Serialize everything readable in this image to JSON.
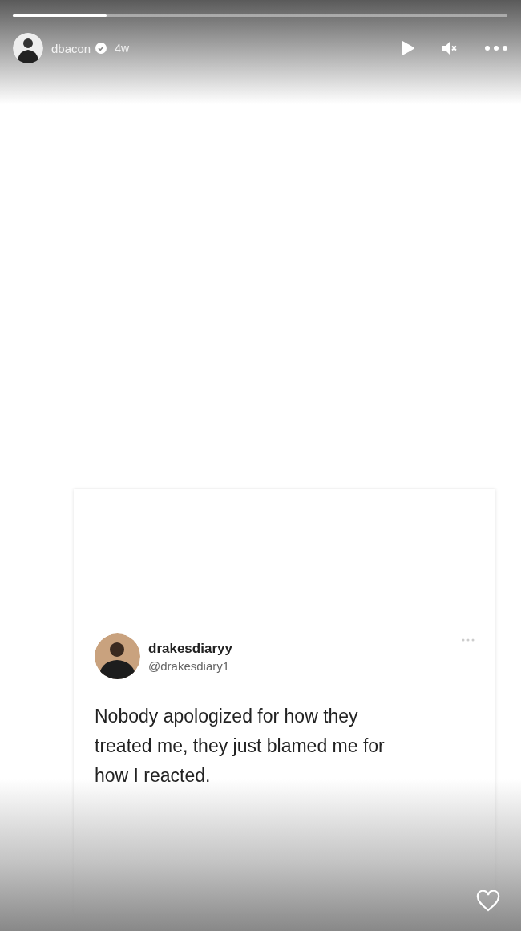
{
  "story": {
    "progress": {
      "level": 0.19
    },
    "username": "dbacon",
    "verified": true,
    "time": "4w",
    "paused": true,
    "muted": true
  },
  "tweet": {
    "display_name": "drakesdiaryy",
    "handle": "@drakesdiary1",
    "text": "Nobody apologized for how they treated me, they just blamed me for how I reacted."
  },
  "liked": false
}
